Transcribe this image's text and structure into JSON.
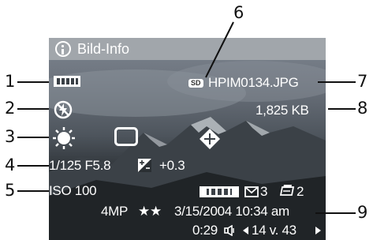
{
  "callouts": {
    "n1": "1",
    "n2": "2",
    "n3": "3",
    "n4": "4",
    "n5": "5",
    "n6": "6",
    "n7": "7",
    "n8": "8",
    "n9": "9"
  },
  "screen": {
    "title": "Bild-Info",
    "sd_badge": "SD",
    "filename": "HPIM0134.JPG",
    "filesize": "1,825 KB",
    "exposure": "1/125 F5.8",
    "ev_comp": "+0.3",
    "iso": "ISO 100",
    "email_count": "3",
    "print_count": "2",
    "resolution": "4MP",
    "stars": "★★",
    "datetime": "3/15/2004 10:34 am",
    "duration": "0:29",
    "image_position": "14 v. 43"
  },
  "colors": {
    "title_bar": "#a1a6ab",
    "text": "#ffffff",
    "callout_text": "#111111"
  },
  "icons": [
    "info-icon",
    "panorama-icon",
    "flash-off-icon",
    "sun-icon",
    "white-frame-icon",
    "focus-target-icon",
    "ev-compensation-icon",
    "panorama-sequence-icon",
    "email-icon",
    "print-icon",
    "audio-icon",
    "left-arrow-icon",
    "right-arrow-icon"
  ]
}
